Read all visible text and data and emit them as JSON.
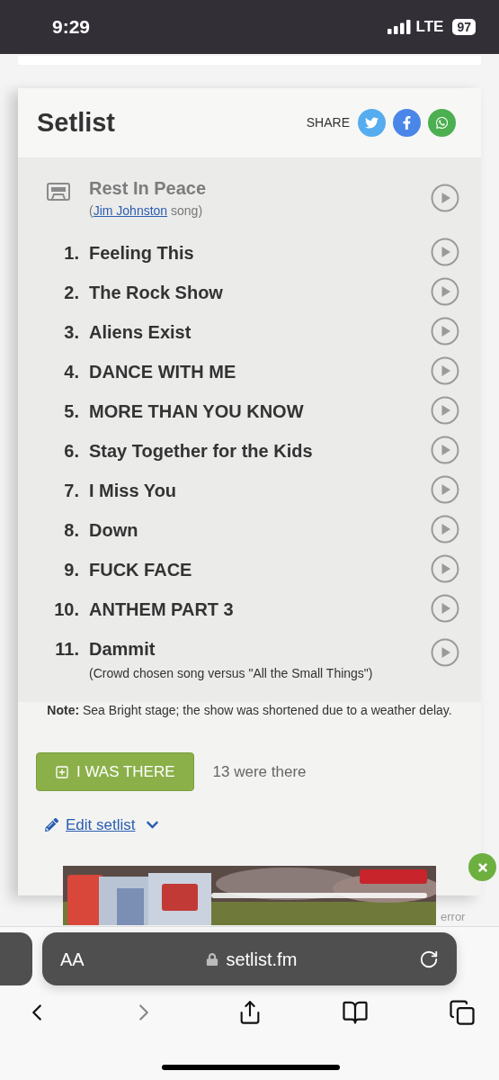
{
  "status_bar": {
    "time": "9:29",
    "network": "LTE",
    "battery": "97"
  },
  "setlist": {
    "title": "Setlist",
    "share_label": "SHARE",
    "share_buttons": [
      {
        "kind": "twitter"
      },
      {
        "kind": "facebook"
      },
      {
        "kind": "whatsapp"
      }
    ],
    "songs": [
      {
        "kind": "tape",
        "title": "Rest In Peace",
        "info_prefix": "(",
        "info_link": "Jim Johnston",
        "info_suffix": "song)"
      },
      {
        "kind": "song",
        "number": "1.",
        "title": "Feeling This"
      },
      {
        "kind": "song",
        "number": "2.",
        "title": "The Rock Show"
      },
      {
        "kind": "song",
        "number": "3.",
        "title": "Aliens Exist"
      },
      {
        "kind": "song",
        "number": "4.",
        "title": "DANCE WITH ME"
      },
      {
        "kind": "song",
        "number": "5.",
        "title": "MORE THAN YOU KNOW"
      },
      {
        "kind": "song",
        "number": "6.",
        "title": "Stay Together for the Kids"
      },
      {
        "kind": "song",
        "number": "7.",
        "title": "I Miss You"
      },
      {
        "kind": "song",
        "number": "8.",
        "title": "Down"
      },
      {
        "kind": "song",
        "number": "9.",
        "title": "FUCK FACE"
      },
      {
        "kind": "song",
        "number": "10.",
        "title": "ANTHEM PART 3"
      },
      {
        "kind": "song",
        "number": "11.",
        "title": "Dammit",
        "info": "(Crowd chosen song versus \"All the Small Things\")"
      }
    ],
    "note": "**Note:** Sea Bright stage; the show was shortened due to a weather delay.",
    "attend_button": "I WAS THERE",
    "attend_count": "13 were there",
    "edit_link": "Edit setlist"
  },
  "ad": {
    "kind": "picture",
    "status": "error"
  },
  "browser": {
    "text_size": "AA",
    "url": "setlist.fm"
  }
}
